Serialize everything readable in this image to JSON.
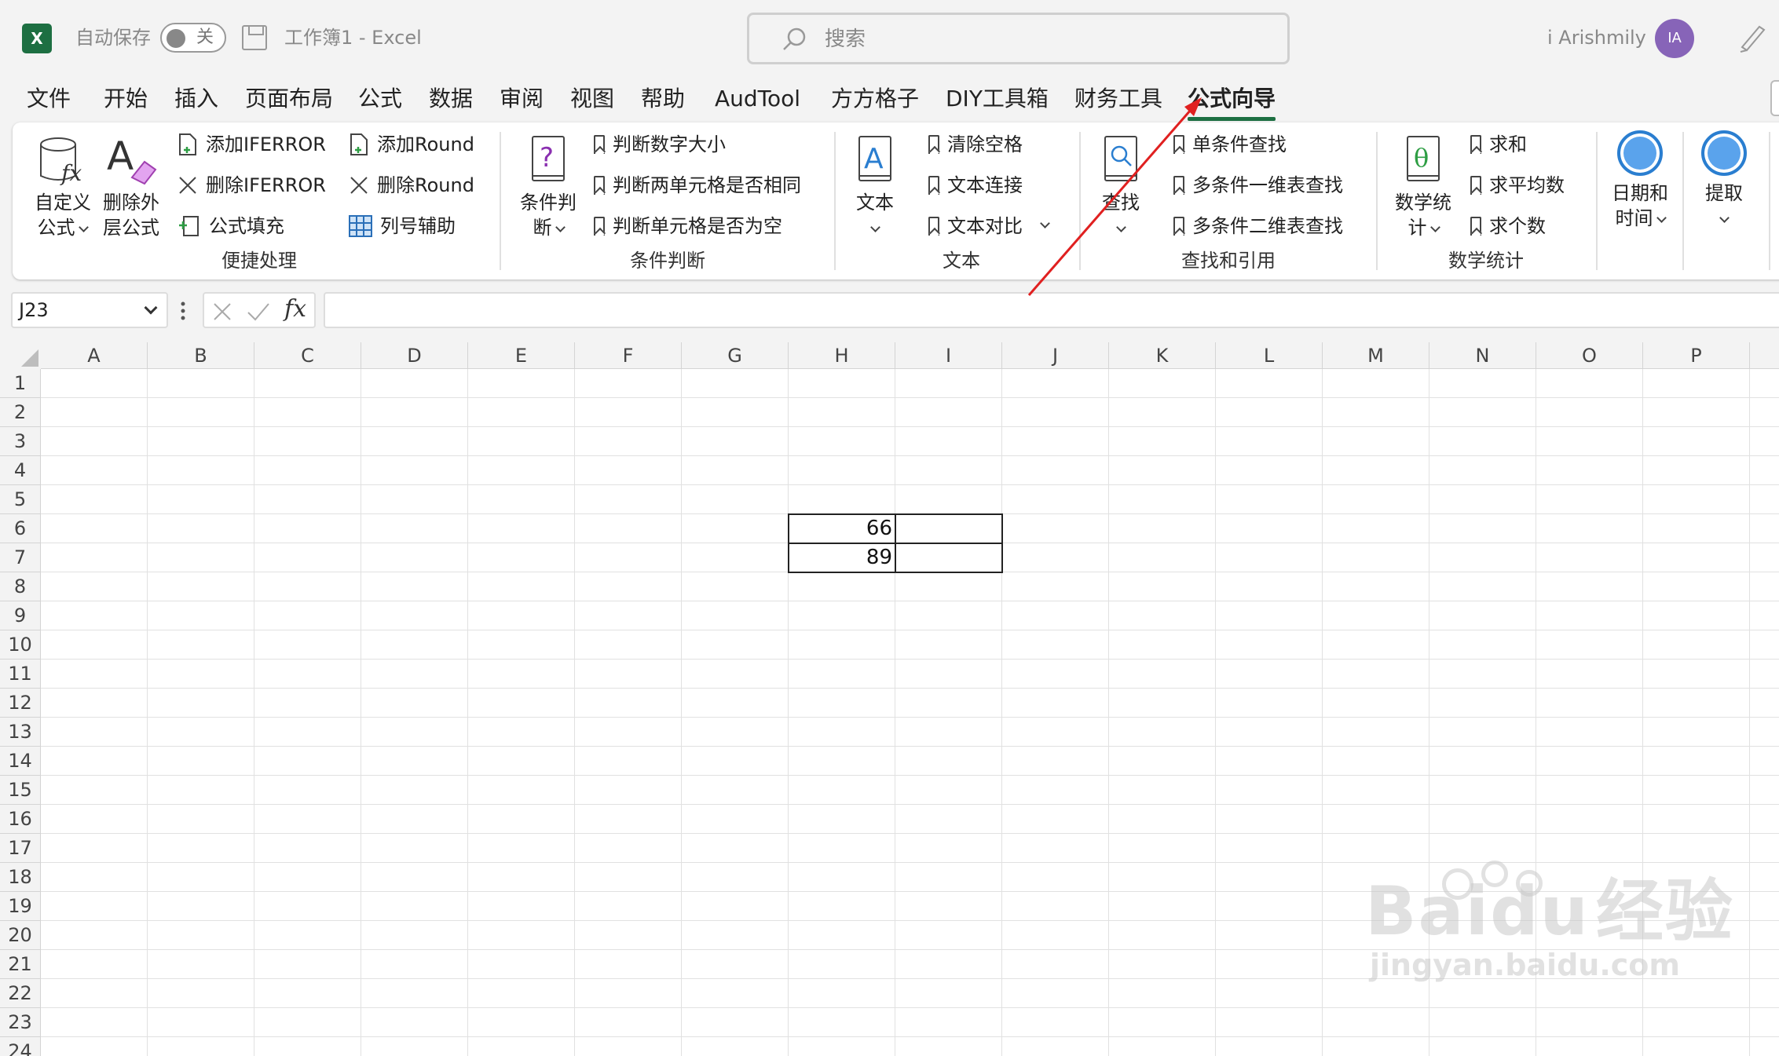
{
  "titlebar": {
    "autosave_label": "自动保存",
    "toggle_state": "关",
    "doc_title": "工作簿1  -  Excel",
    "search_placeholder": "搜索",
    "user_name": "i Arishmily",
    "avatar_initials": "IA",
    "excel_logo": "X"
  },
  "tabs": [
    "文件",
    "开始",
    "插入",
    "页面布局",
    "公式",
    "数据",
    "审阅",
    "视图",
    "帮助",
    "AudTool",
    "方方格子",
    "DIY工具箱",
    "财务工具",
    "公式向导"
  ],
  "active_tab": "公式向导",
  "ribbon": {
    "custom_formula": {
      "line1": "自定义",
      "line2": "公式"
    },
    "delete_outer": {
      "line1": "删除外",
      "line2": "层公式"
    },
    "add_iferror": "添加IFERROR",
    "delete_iferror": "删除IFERROR",
    "formula_fill": "公式填充",
    "add_round": "添加Round",
    "delete_round": "删除Round",
    "col_helper": "列号辅助",
    "group_quick": "便捷处理",
    "cond_judge": {
      "line1": "条件判",
      "line2": "断"
    },
    "judge_num_size": "判断数字大小",
    "judge_two_same": "判断两单元格是否相同",
    "judge_empty": "判断单元格是否为空",
    "group_cond": "条件判断",
    "text_btn": "文本",
    "clear_space": "清除空格",
    "text_join": "文本连接",
    "text_compare": "文本对比",
    "group_text": "文本",
    "find_btn": "查找",
    "single_find": "单条件查找",
    "multi_1d_find": "多条件一维表查找",
    "multi_2d_find": "多条件二维表查找",
    "group_lookup": "查找和引用",
    "math_stat": {
      "line1": "数学统",
      "line2": "计"
    },
    "sum": "求和",
    "average": "求平均数",
    "count": "求个数",
    "group_math": "数学统计",
    "datetime": {
      "line1": "日期和",
      "line2": "时间"
    },
    "extract": "提取"
  },
  "formula_bar": {
    "name_box": "J23",
    "fx": "fx",
    "formula": ""
  },
  "columns": [
    "A",
    "B",
    "C",
    "D",
    "E",
    "F",
    "G",
    "H",
    "I",
    "J",
    "K",
    "L",
    "M",
    "N",
    "O",
    "P"
  ],
  "rows": [
    "1",
    "2",
    "3",
    "4",
    "5",
    "6",
    "7",
    "8",
    "9",
    "10",
    "11",
    "12",
    "13",
    "14",
    "15",
    "16",
    "17",
    "18",
    "19",
    "20",
    "21",
    "22",
    "23",
    "24"
  ],
  "cells": {
    "H6": "66",
    "H7": "89"
  },
  "watermark": {
    "brand": "Bai",
    "brand2": "du",
    "cn": "经验",
    "url": "jingyan.baidu.com"
  }
}
